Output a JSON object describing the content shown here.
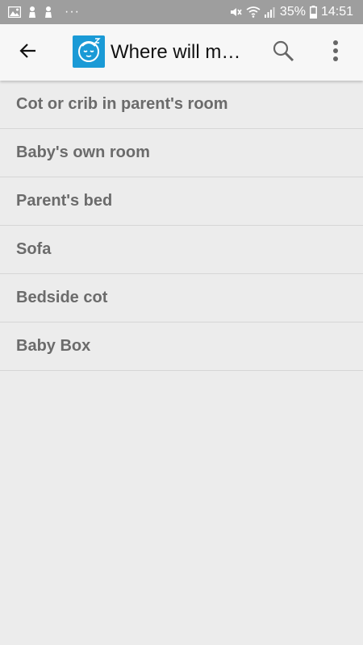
{
  "status_bar": {
    "battery": "35%",
    "time": "14:51",
    "dots": "···",
    "icons": [
      "image-icon",
      "notification-icon",
      "notification-icon",
      "mute-icon",
      "wifi-icon",
      "signal-icon",
      "battery-icon"
    ]
  },
  "app_bar": {
    "title": "Where will my baby sleep?",
    "back_icon": "arrow-left-icon",
    "logo_icon": "sleeping-baby-icon",
    "search_icon": "search-icon",
    "more_icon": "more-vertical-icon"
  },
  "colors": {
    "status_bar": "#9e9e9e",
    "app_bar": "#f7f7f7",
    "background": "#ececec",
    "item_text": "#6b6b6b",
    "logo_bg": "#1a9ad6"
  },
  "list": {
    "items": [
      {
        "label": "Cot or crib in parent's room"
      },
      {
        "label": "Baby's own room"
      },
      {
        "label": "Parent's bed"
      },
      {
        "label": "Sofa"
      },
      {
        "label": "Bedside cot"
      },
      {
        "label": "Baby Box"
      }
    ]
  }
}
